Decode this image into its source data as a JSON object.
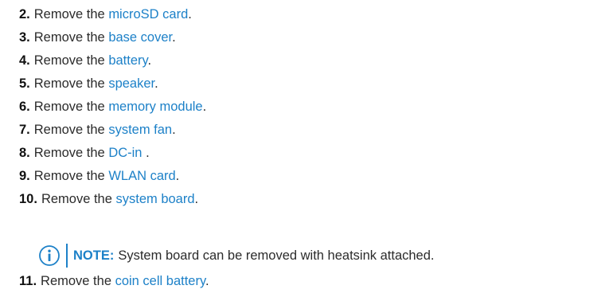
{
  "steps": [
    {
      "num": "2.",
      "prefix": "Remove the ",
      "link": "microSD card",
      "suffix": "."
    },
    {
      "num": "3.",
      "prefix": "Remove the ",
      "link": "base cover",
      "suffix": "."
    },
    {
      "num": "4.",
      "prefix": "Remove the ",
      "link": "battery",
      "suffix": "."
    },
    {
      "num": "5.",
      "prefix": "Remove the ",
      "link": "speaker",
      "suffix": "."
    },
    {
      "num": "6.",
      "prefix": "Remove the ",
      "link": "memory module",
      "suffix": "."
    },
    {
      "num": "7.",
      "prefix": "Remove the ",
      "link": "system fan",
      "suffix": "."
    },
    {
      "num": "8.",
      "prefix": "Remove the ",
      "link": "DC-in",
      "suffix": " ."
    },
    {
      "num": "9.",
      "prefix": "Remove the ",
      "link": "WLAN card",
      "suffix": "."
    },
    {
      "num": "10.",
      "prefix": "Remove the ",
      "link": "system board",
      "suffix": "."
    },
    {
      "num": "11.",
      "prefix": "Remove the ",
      "link": "coin cell battery",
      "suffix": "."
    }
  ],
  "note": {
    "icon": "info-icon",
    "label": "NOTE:",
    "text": "System board can be removed with heatsink attached."
  },
  "colors": {
    "link": "#1d81c8",
    "text": "#2b2b2b"
  }
}
